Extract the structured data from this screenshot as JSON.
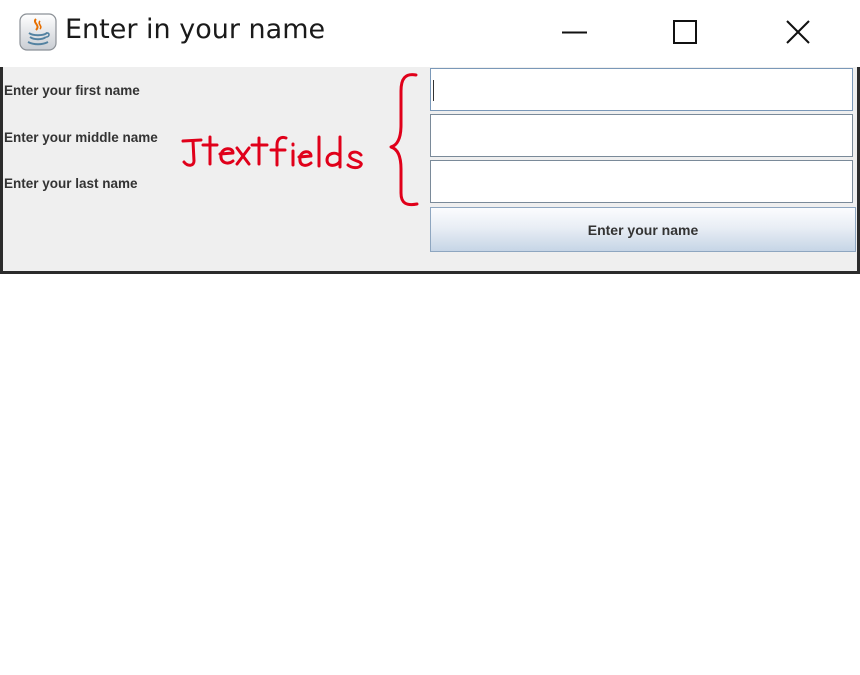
{
  "window": {
    "title": "Enter in your name",
    "app_icon": "java-icon",
    "controls": {
      "minimize_icon": "minimize-icon",
      "maximize_icon": "maximize-icon",
      "close_icon": "close-icon"
    }
  },
  "form": {
    "first_name_label": "Enter your first name",
    "middle_name_label": "Enter your middle name",
    "last_name_label": "Enter your last name",
    "first_name_value": "",
    "middle_name_value": "",
    "last_name_value": "",
    "submit_label": "Enter your name"
  },
  "annotation": {
    "text": "Jtext fields",
    "color": "#e0001a"
  },
  "colors": {
    "panel_background": "#efefef",
    "title_bar": "#ffffff",
    "window_border": "#2b2b2b"
  }
}
